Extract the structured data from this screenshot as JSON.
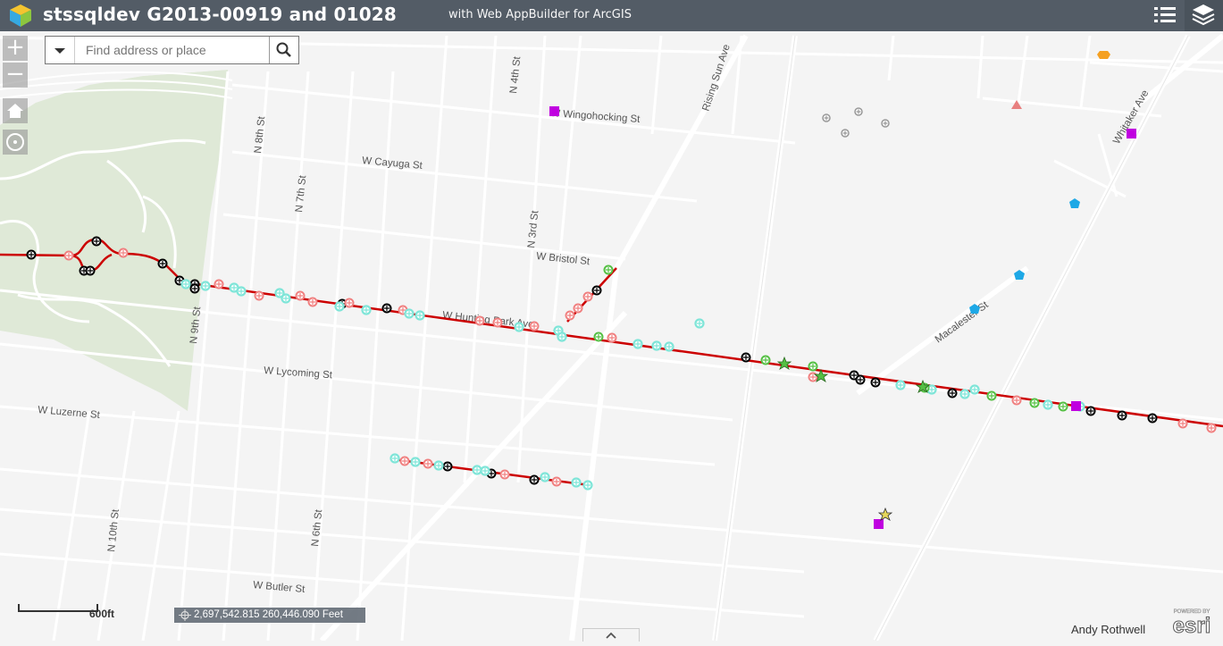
{
  "header": {
    "title": "stssqldev G2013-00919 and 01028",
    "subtitle": "with Web AppBuilder for ArcGIS"
  },
  "search": {
    "placeholder": "Find address or place"
  },
  "zoom": {
    "in_label": "+",
    "out_label": "−"
  },
  "streets": [
    {
      "name": "W Wingohocking St"
    },
    {
      "name": "W Cayuga St"
    },
    {
      "name": "W Bristol St"
    },
    {
      "name": "W Hunting Park Ave"
    },
    {
      "name": "W Lycoming St"
    },
    {
      "name": "W Luzerne St"
    },
    {
      "name": "W Butler St"
    },
    {
      "name": "N 8th St"
    },
    {
      "name": "N 7th St"
    },
    {
      "name": "N 9th St"
    },
    {
      "name": "N 4th St"
    },
    {
      "name": "N 3rd St"
    },
    {
      "name": "Rising Sun Ave"
    },
    {
      "name": "Whitaker Ave"
    },
    {
      "name": "Macalester St"
    },
    {
      "name": "N 10th St"
    },
    {
      "name": "N 6th St"
    }
  ],
  "scale": {
    "label": "600ft"
  },
  "coordinates": "2,697,542.815 260,446.090 Feet",
  "attribution": "Andy Rothwell",
  "esri": {
    "powered": "POWERED BY",
    "brand": "esri"
  },
  "colors": {
    "header": "#535c66",
    "route": "#cc0000",
    "symbol_salmon": "#f08080",
    "symbol_cyan": "#7fe5d8",
    "symbol_green": "#55c044",
    "symbol_black": "#000000",
    "symbol_magenta": "#c000e0",
    "symbol_blue": "#1ea8e6",
    "symbol_orange": "#f5a020",
    "park": "#dfe9d7"
  }
}
